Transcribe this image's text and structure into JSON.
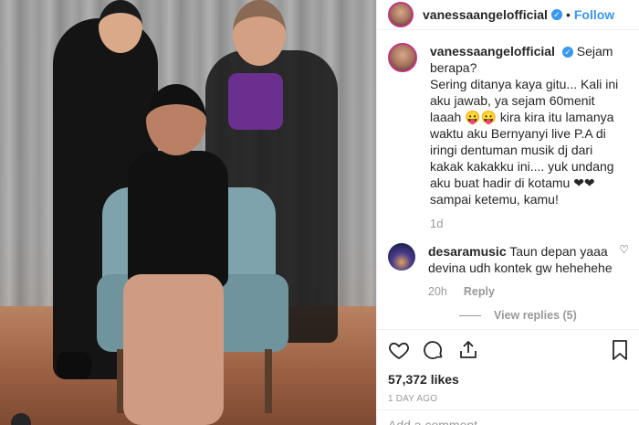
{
  "post": {
    "username": "vanessaangelofficial",
    "follow_label": "Follow",
    "separator": "•"
  },
  "caption": {
    "username": "vanessaangelofficial",
    "text": " Sejam berapa?\nSering ditanya kaya gitu... Kali ini aku jawab, ya sejam 60menit laaah 😛😛 kira kira itu lamanya waktu aku Bernyanyi live P.A di iringi dentuman musik dj dari kakak kakakku ini.... yuk undang aku buat hadir di kotamu ❤❤ sampai ketemu, kamu!",
    "time": "1d"
  },
  "comments": [
    {
      "username": "desaramusic",
      "text": " Taun depan yaaa devina udh kontek gw hehehehe",
      "time": "20h",
      "reply_label": "Reply",
      "view_replies": "View replies (5)"
    }
  ],
  "stats": {
    "likes": "57,372 likes",
    "time_ago": "1 DAY AGO"
  },
  "add_comment_placeholder": "Add a comment…",
  "colors": {
    "accent": "#3897f0",
    "muted": "#999999",
    "text": "#262626"
  },
  "icons": [
    "heart-icon",
    "comment-icon",
    "share-icon",
    "bookmark-icon",
    "verified-icon"
  ]
}
